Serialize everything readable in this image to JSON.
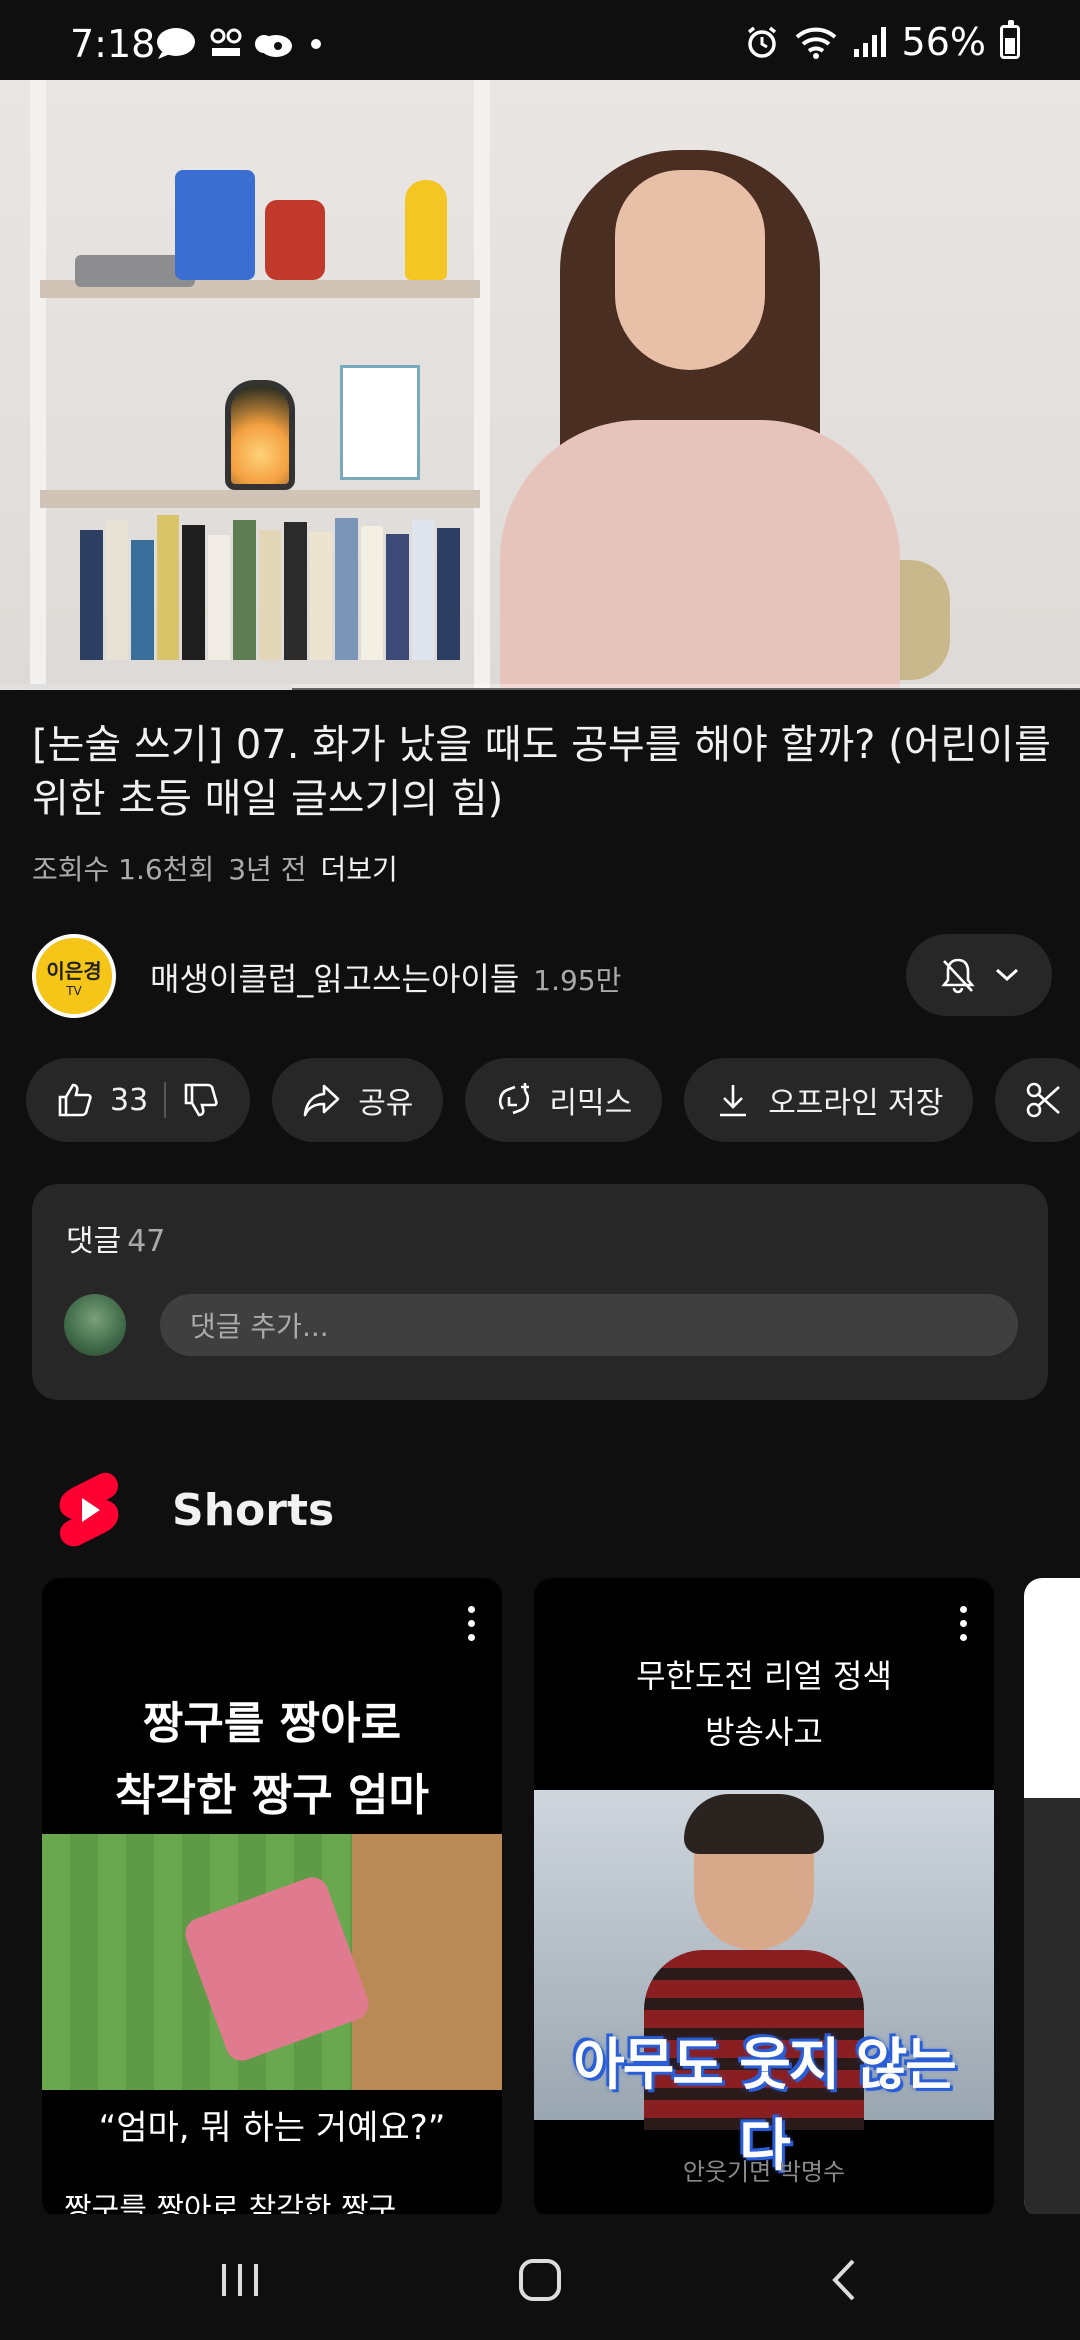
{
  "status_bar": {
    "time": "7:18",
    "battery": "56%",
    "battery_level": 0.56
  },
  "player": {
    "progress": 0.27
  },
  "video": {
    "title": "[논술 쓰기] 07. 화가 났을 때도 공부를 해야 할까? (어린이를 위한 초등 매일 글쓰기의 힘)",
    "views": "조회수 1.6천회",
    "age": "3년 전",
    "more": "더보기"
  },
  "channel": {
    "avatar_line1": "이은경",
    "avatar_line2": "TV",
    "name": "매생이클럽_읽고쓰는아이들",
    "subscribers": "1.95만"
  },
  "actions": {
    "likes": "33",
    "share": "공유",
    "remix": "리믹스",
    "download": "오프라인 저장"
  },
  "comments": {
    "label": "댓글",
    "count": "47",
    "placeholder": "댓글 추가..."
  },
  "shorts": {
    "header": "Shorts",
    "items": [
      {
        "title_line1": "짱구를 짱아로",
        "title_line2": "착각한 짱구 엄마",
        "quote": "“엄마, 뭐 하는 거예요?”",
        "caption": "짱구를 짱아로 착각한 짱구"
      },
      {
        "title_line1": "무한도전 리얼 정색",
        "title_line2": "방송사고",
        "overlay": "아무도 웃지 않는다",
        "caption": "안웃기면 박명수"
      }
    ]
  },
  "colors": {
    "background": "#0f0f0f",
    "surface": "#272727",
    "text_primary": "#f1f1f1",
    "text_secondary": "#aaaaaa",
    "shorts_red": "#ff0033"
  },
  "icons": {
    "bell": "bell-off-icon",
    "like": "thumbs-up-icon",
    "dislike": "thumbs-down-icon",
    "share": "share-icon",
    "remix": "remix-icon",
    "download": "download-icon",
    "clip": "scissors-icon"
  }
}
